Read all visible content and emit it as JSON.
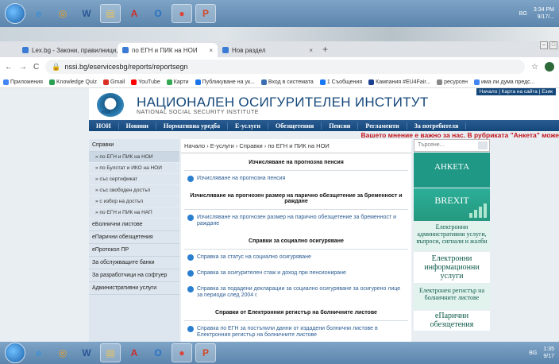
{
  "taskbar": {
    "apps": [
      {
        "name": "ie-icon",
        "glyph": "e",
        "color": "#3b8fd8",
        "active": false
      },
      {
        "name": "chrome-small-icon",
        "glyph": "◎",
        "color": "#f0a020",
        "active": false
      },
      {
        "name": "word-icon",
        "glyph": "W",
        "color": "#2b5797",
        "active": false
      },
      {
        "name": "explorer-icon",
        "glyph": "▤",
        "color": "#e8c25a",
        "active": true
      },
      {
        "name": "acrobat-icon",
        "glyph": "A",
        "color": "#c9302c",
        "active": false
      },
      {
        "name": "outlook-icon",
        "glyph": "O",
        "color": "#2a72c6",
        "active": false
      },
      {
        "name": "chrome-icon",
        "glyph": "●",
        "color": "#db4437",
        "active": true
      },
      {
        "name": "powerpoint-icon",
        "glyph": "P",
        "color": "#d24726",
        "active": true
      }
    ],
    "tray_lang": "BG",
    "top_time": "3:34 PM",
    "top_date": "9/17/...",
    "bottom_time": "1:35",
    "bottom_date": "9/17"
  },
  "browser": {
    "tabs": [
      {
        "label": "Lex.bg - Закони, правилници, с",
        "active": false
      },
      {
        "label": "по ЕГН и ПИК на НОИ",
        "active": true
      },
      {
        "label": "Нов раздел",
        "active": false
      }
    ],
    "url": "nssi.bg/eservicesbg/reports/reportsegn",
    "bookmarks": [
      {
        "label": "Приложения",
        "color": "#4285f4"
      },
      {
        "label": "Knowledge Quiz",
        "color": "#2aa052"
      },
      {
        "label": "Gmail",
        "color": "#d93025"
      },
      {
        "label": "YouTube",
        "color": "#ff0000"
      },
      {
        "label": "Карти",
        "color": "#34a853"
      },
      {
        "label": "Публикуване на ук...",
        "color": "#1a73e8"
      },
      {
        "label": "Вход в системата",
        "color": "#3b6db3"
      },
      {
        "label": "1 Съобщения",
        "color": "#1877f2"
      },
      {
        "label": "Кампания #EU4Fair...",
        "color": "#1a3f8f"
      },
      {
        "label": "ресурсен",
        "color": "#888888"
      },
      {
        "label": "има ли дума предс...",
        "color": "#4285f4"
      }
    ]
  },
  "site": {
    "title": "НАЦИОНАЛЕН ОСИГУРИТЕЛЕН ИНСТИТУТ",
    "subtitle": "NATIONAL SOCIAL SECURITY INSTITUTE",
    "logo_text": "НОИ",
    "top_links": "Начало | Карта на сайта | Език",
    "nav": [
      "НОИ",
      "Новини",
      "Нормативна уредба",
      "Е-услуги",
      "Обезщетения",
      "Пенсии",
      "Регламенти",
      "За потребителя"
    ],
    "notice": "Вашето мнение е важно за нас. В рубриката \"Анкета\" може",
    "sidebar": {
      "head": "Справки",
      "subs": [
        {
          "label": "по ЕГН и ПИК на НОИ",
          "selected": true
        },
        {
          "label": "по Булстат и ИКО на НОИ",
          "selected": false
        },
        {
          "label": "със сертификат",
          "selected": false
        },
        {
          "label": "със свободен достъп",
          "selected": false
        },
        {
          "label": "с избор на достъп",
          "selected": false
        },
        {
          "label": "по ЕГН и ПИК на НАП",
          "selected": false
        }
      ],
      "sections": [
        "еБолнични листове",
        "еПарични обезщетения",
        "еПротокол ПР",
        "За обслужващите банки",
        "За разработчици на софтуер",
        "Административни услуги"
      ]
    },
    "main": {
      "breadcrumb": "Начало › Е-услуги › Справки › по ЕГН и ПИК на НОИ",
      "sections": [
        {
          "title": "Изчисляване на прогнозна пенсия",
          "items": [
            "Изчисляване на прогнозна пенсия"
          ]
        },
        {
          "title": "Изчисляване на прогнозен размер на парично обезщетение за бременност и раждане",
          "items": [
            "Изчисляване на прогнозен размер на парично обезщетение за бременност и раждане"
          ]
        },
        {
          "title": "Справки за социално осигуряване",
          "items": [
            "Справка за статус на социално осигуряване",
            "Справка за осигурителен стаж и доход при пенсиониране",
            "Справка за подадени декларации за социално осигуряване за осигурено лице за периоди след 2004 г."
          ]
        },
        {
          "title": "Справки от Електронния регистър на болничните листове",
          "items": [
            "Справка по ЕГН за постъпили данни от издадени болнични листове в Електронния регистър на болничните листове"
          ]
        }
      ]
    },
    "right": {
      "search_placeholder": "Търсене...",
      "banners": [
        "АНКЕТА",
        "BREXIT",
        "Електронни административни услуги, въпроси, сигнали и жалби",
        "Електронни информационни услуги",
        "Електронен регистър на болничните листове",
        "еПарични обезщетения"
      ]
    }
  }
}
